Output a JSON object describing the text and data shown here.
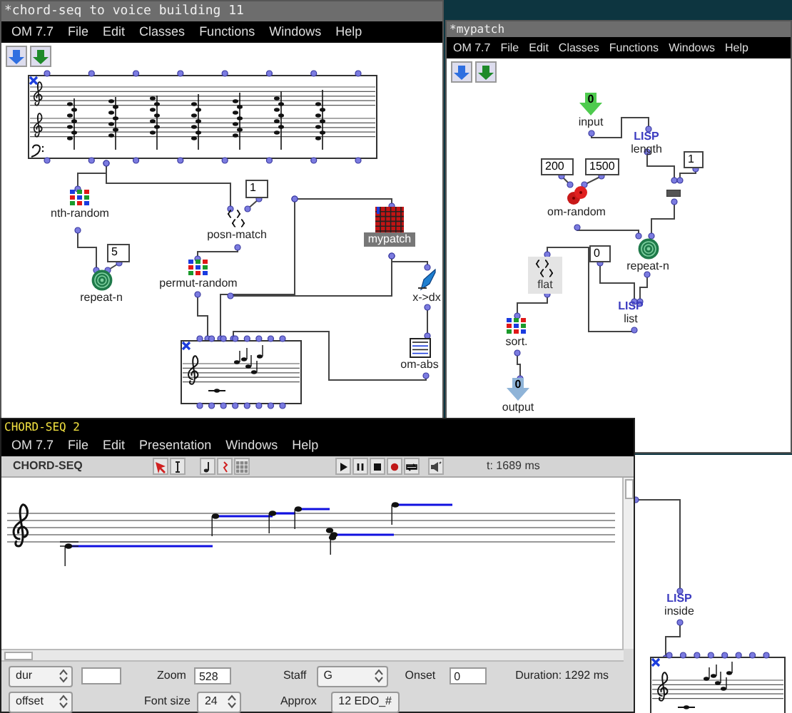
{
  "patch_window": {
    "title": "*chord-seq to voice building 11",
    "menu": [
      "OM 7.7",
      "File",
      "Edit",
      "Classes",
      "Functions",
      "Windows",
      "Help"
    ],
    "boxes": [
      {
        "kind": "score"
      },
      {
        "kind": "value",
        "text": "1"
      },
      {
        "kind": "random",
        "label": "nth-random"
      },
      {
        "kind": "match",
        "label": "posn-match"
      },
      {
        "kind": "patch",
        "label": "mypatch"
      },
      {
        "kind": "value",
        "text": "5"
      },
      {
        "kind": "spiral",
        "label": "repeat-n"
      },
      {
        "kind": "random",
        "label": "permut-random"
      },
      {
        "kind": "pen",
        "label": "x->dx"
      },
      {
        "kind": "abs",
        "label": "om-abs"
      },
      {
        "kind": "score"
      }
    ]
  },
  "subpatch_window": {
    "title": "*mypatch",
    "menu": [
      "OM 7.7",
      "File",
      "Edit",
      "Classes",
      "Functions",
      "Windows",
      "Help"
    ],
    "boxes": [
      {
        "kind": "input",
        "text": "0",
        "label": "input"
      },
      {
        "kind": "lisp",
        "text": "LISP",
        "label": "length"
      },
      {
        "kind": "value",
        "text": "200"
      },
      {
        "kind": "value",
        "text": "1500"
      },
      {
        "kind": "value",
        "text": "1"
      },
      {
        "kind": "dice",
        "label": "om-random"
      },
      {
        "kind": "bar"
      },
      {
        "kind": "spiral",
        "label": "repeat-n"
      },
      {
        "kind": "value",
        "text": "0"
      },
      {
        "kind": "flat",
        "label": "flat"
      },
      {
        "kind": "lisp",
        "text": "LISP",
        "label": "list"
      },
      {
        "kind": "random",
        "label": "sort."
      },
      {
        "kind": "output",
        "text": "0",
        "label": "output"
      }
    ]
  },
  "background_patch": {
    "boxes": [
      {
        "kind": "lisp",
        "text": "LISP",
        "label": "inside"
      },
      {
        "kind": "score"
      }
    ]
  },
  "editor_window": {
    "title": "CHORD-SEQ 2",
    "menu": [
      "OM 7.7",
      "File",
      "Edit",
      "Presentation",
      "Windows",
      "Help"
    ],
    "editor_label": "CHORD-SEQ",
    "time": "t: 1689 ms",
    "control_rows": [
      [
        {
          "kind": "select",
          "text": "dur"
        },
        {
          "kind": "field",
          "text": ""
        },
        {
          "kind": "label",
          "text": "Zoom"
        },
        {
          "kind": "field",
          "text": "528"
        },
        {
          "kind": "label",
          "text": "Staff"
        },
        {
          "kind": "select",
          "text": "G"
        },
        {
          "kind": "label",
          "text": "Onset"
        },
        {
          "kind": "field",
          "text": "0"
        },
        {
          "kind": "label",
          "text": "Duration: 1292 ms"
        }
      ],
      [
        {
          "kind": "select",
          "text": "offset"
        },
        {
          "kind": "label",
          "text": "Font size"
        },
        {
          "kind": "select",
          "text": "24"
        },
        {
          "kind": "label",
          "text": "Approx"
        },
        {
          "kind": "button",
          "text": "12 EDO_#"
        }
      ]
    ]
  }
}
